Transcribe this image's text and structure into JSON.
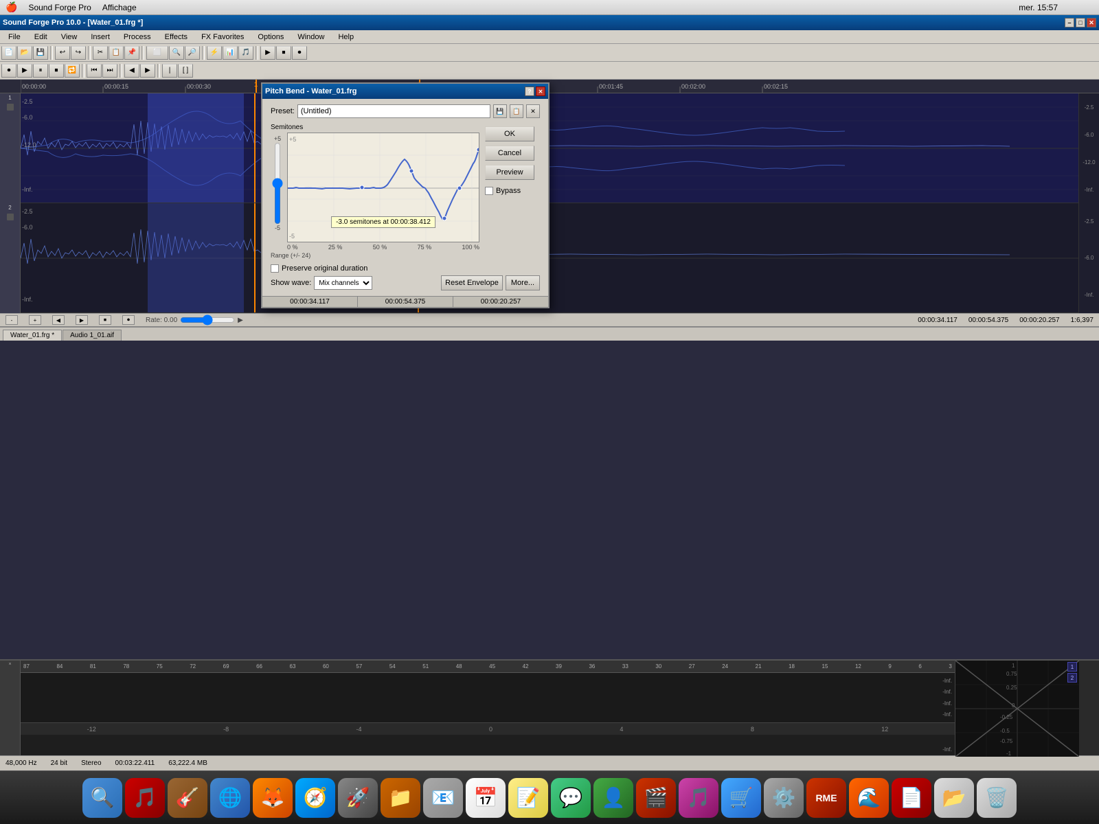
{
  "macMenubar": {
    "apple": "🍎",
    "appName": "Sound Forge Pro",
    "menu2": "Affichage",
    "time": "mer. 15:57",
    "wifiIcon": "WiFi",
    "batteryIcon": "Battery"
  },
  "appTitlebar": {
    "title": "Sound Forge Pro 10.0 - [Water_01.frg *]",
    "minimizeBtn": "–",
    "maximizeBtn": "□",
    "closeBtn": "✕"
  },
  "appMenu": {
    "items": [
      "File",
      "Edit",
      "View",
      "Insert",
      "Process",
      "Effects",
      "FX Favorites",
      "Options",
      "Window",
      "Help"
    ]
  },
  "dialog": {
    "title": "Pitch Bend - Water_01.frg",
    "helpBtn": "?",
    "closeBtn": "✕",
    "presetLabel": "Preset:",
    "presetValue": "(Untitled)",
    "semitonesLabel": "Semitones",
    "graphPlus5": "+5",
    "graphMinus5": "-5",
    "tooltip": "-3.0 semitones at 00:00:38.412",
    "rangeLabelTop": "Range",
    "rangeLabelBot": "(+/- 24)",
    "pct0": "0 %",
    "pct25": "25 %",
    "pct50": "50 %",
    "pct75": "75 %",
    "pct100": "100 %",
    "okBtn": "OK",
    "cancelBtn": "Cancel",
    "previewBtn": "Preview",
    "bypassLabel": "Bypass",
    "preserveLabel": "Preserve original duration",
    "showWaveLabel": "Show wave:",
    "showWaveOption": "Mix channels",
    "resetBtn": "Reset Envelope",
    "moreBtn": "More...",
    "timecode1": "00:00:34.117",
    "timecode2": "00:00:54.375",
    "timecode3": "00:00:20.257"
  },
  "statusBar": {
    "rate": "Rate: 0.00",
    "time1": "00:00:34.117",
    "time2": "00:00:54.375",
    "time3": "00:00:20.257",
    "zoom": "1:6,397"
  },
  "tabs": [
    {
      "label": "Water_01.frg *",
      "active": true
    },
    {
      "label": "Audio 1_01.aif",
      "active": false
    }
  ],
  "lowerPanel": {
    "numbers": [
      "87",
      "84",
      "81",
      "78",
      "75",
      "72",
      "69",
      "66",
      "63",
      "60",
      "57",
      "54",
      "51",
      "48",
      "45",
      "42",
      "39",
      "36",
      "33",
      "30",
      "27",
      "24",
      "21",
      "18",
      "15",
      "12",
      "9",
      "6",
      "3"
    ],
    "dbScale": [
      "-Inf.",
      "",
      "",
      "",
      ""
    ],
    "dbScaleRight": [
      "1",
      "0.75",
      "0.25",
      "0",
      "0.25",
      "0.5",
      "0.75",
      "1"
    ],
    "equalizerNumbers": [
      "-12",
      "-8",
      "-4",
      "0",
      "4",
      "8",
      "12"
    ]
  },
  "bottomStatus": {
    "sampleRate": "48,000 Hz",
    "bitDepth": "24 bit",
    "channels": "Stereo",
    "duration": "00:03:22.411",
    "fileSize": "63,222.4 MB"
  },
  "dock": {
    "icons": [
      "🔍",
      "🎵",
      "🌐",
      "🚀",
      "📁",
      "📧",
      "📅",
      "📝",
      "💬",
      "👤",
      "🎬",
      "🎸",
      "🛒",
      "⚙️",
      "🎯",
      "📄",
      "📂",
      "🗑️"
    ]
  }
}
